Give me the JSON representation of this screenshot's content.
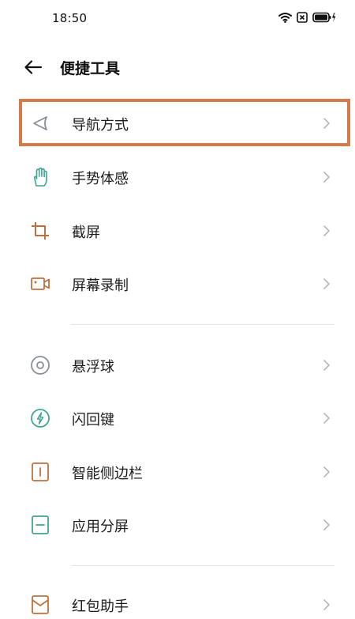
{
  "status": {
    "time": "18:50"
  },
  "header": {
    "title": "便捷工具"
  },
  "items": [
    {
      "label": "导航方式",
      "icon": "navigation-arrow-icon"
    },
    {
      "label": "手势体感",
      "icon": "hand-gesture-icon"
    },
    {
      "label": "截屏",
      "icon": "crop-icon"
    },
    {
      "label": "屏幕录制",
      "icon": "video-record-icon"
    },
    {
      "label": "悬浮球",
      "icon": "floating-ball-icon"
    },
    {
      "label": "闪回键",
      "icon": "flashback-icon"
    },
    {
      "label": "智能侧边栏",
      "icon": "sidebar-icon"
    },
    {
      "label": "应用分屏",
      "icon": "split-screen-icon"
    },
    {
      "label": "红包助手",
      "icon": "red-envelope-icon"
    }
  ],
  "colors": {
    "highlight": "#d67a4a",
    "accent_teal": "#3fa592",
    "accent_orange": "#c0703e",
    "icon_gray": "#8a8f99"
  }
}
